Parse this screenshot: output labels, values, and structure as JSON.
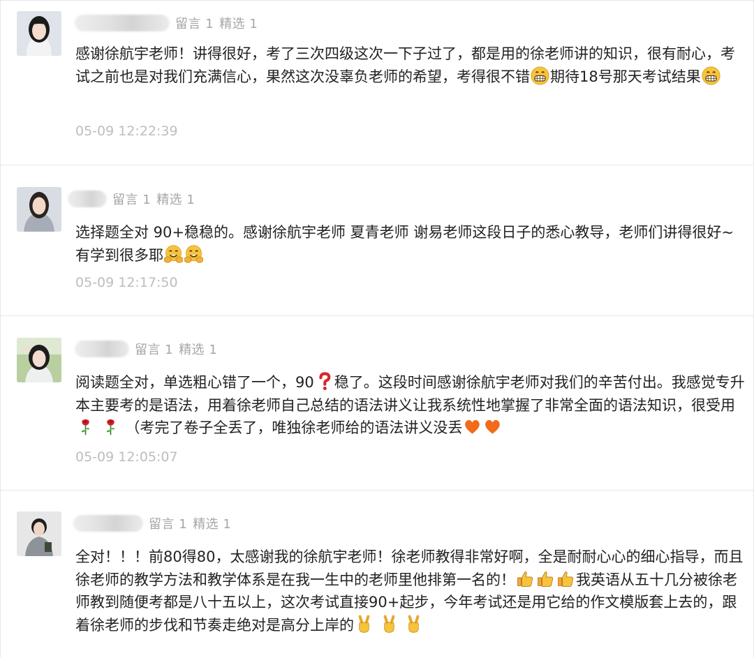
{
  "comments": [
    {
      "stats": {
        "replies": "留言 1",
        "featured": "精选 1"
      },
      "seg1": "感谢徐航宇老师！讲得很好，考了三次四级这次一下子过了，都是用的徐老师讲的知识，很有耐心，考试之前也是对我们充满信心，果然这次没辜负老师的希望，考得很不错",
      "seg2": "期待18号那天考试结果",
      "time": "05-09 12:22:39"
    },
    {
      "stats": {
        "replies": "留言 1",
        "featured": "精选 1"
      },
      "seg1": "选择题全对 90+稳稳的。感谢徐航宇老师 夏青老师 谢易老师这段日子的悉心教导，老师们讲得很好~有学到很多耶",
      "time": "05-09 12:17:50"
    },
    {
      "stats": {
        "replies": "留言 1",
        "featured": "精选 1"
      },
      "seg1": "阅读题全对，单选粗心错了一个，90",
      "seg2": "稳了。这段时间感谢徐航宇老师对我们的辛苦付出。我感觉专升本主要考的是语法，用着徐老师自己总结的语法讲义让我系统性地掌握了非常全面的语法知识，很受用",
      "seg3": "（考完了卷子全丢了，唯独徐老师给的语法讲义没丢",
      "time": "05-09 12:05:07"
    },
    {
      "stats": {
        "replies": "留言 1",
        "featured": "精选 1"
      },
      "seg1": "全对！！！前80得80，太感谢我的徐航宇老师！徐老师教得非常好啊，全是耐耐心心的细心指导，而且徐老师的教学方法和教学体系是在我一生中的老师里他排第一名的！",
      "seg2": "我英语从五十几分被徐老师教到随便考都是八十五以上，这次考试直接90+起步，今年考试还是用它给的作文模版套上去的，跟着徐老师的步伐和节奏走绝对是高分上岸的"
    }
  ],
  "icons": {
    "grin": "grinning-emoji-icon",
    "hug": "hugging-face-emoji-icon",
    "question": "red-question-mark-icon",
    "rose": "rose-icon",
    "heart": "orange-heart-icon",
    "thumbs": "thumbs-up-icon",
    "victory": "victory-hand-icon"
  }
}
